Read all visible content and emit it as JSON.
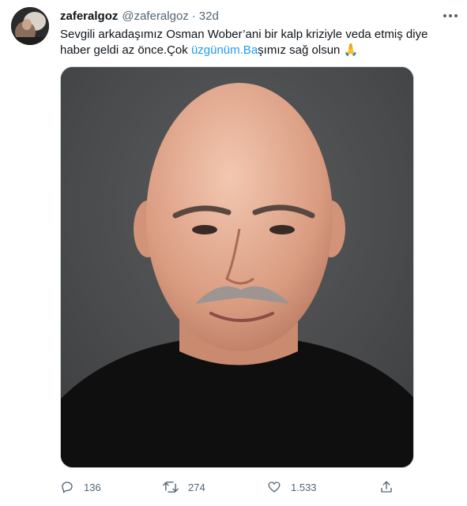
{
  "tweet": {
    "display_name": "zaferalgoz",
    "handle": "@zaferalgoz",
    "separator": "·",
    "time": "32d",
    "text_part1": "Sevgili arkadaşımız Osman Wober’ani bir kalp kriziyle veda etmiş diye haber geldi az önce.Çok ",
    "text_link": "üzgünüm.Ba",
    "text_part2": "şımız sağ olsun ",
    "text_emoji": "🙏",
    "media": {
      "description_icon": "portrait-photo"
    }
  },
  "actions": {
    "reply_count": "136",
    "retweet_count": "274",
    "like_count": "1.533"
  },
  "colors": {
    "text": "#0f1419",
    "secondary": "#536471",
    "link": "#1d9bf0",
    "photo_background": "#4a4b4d"
  }
}
